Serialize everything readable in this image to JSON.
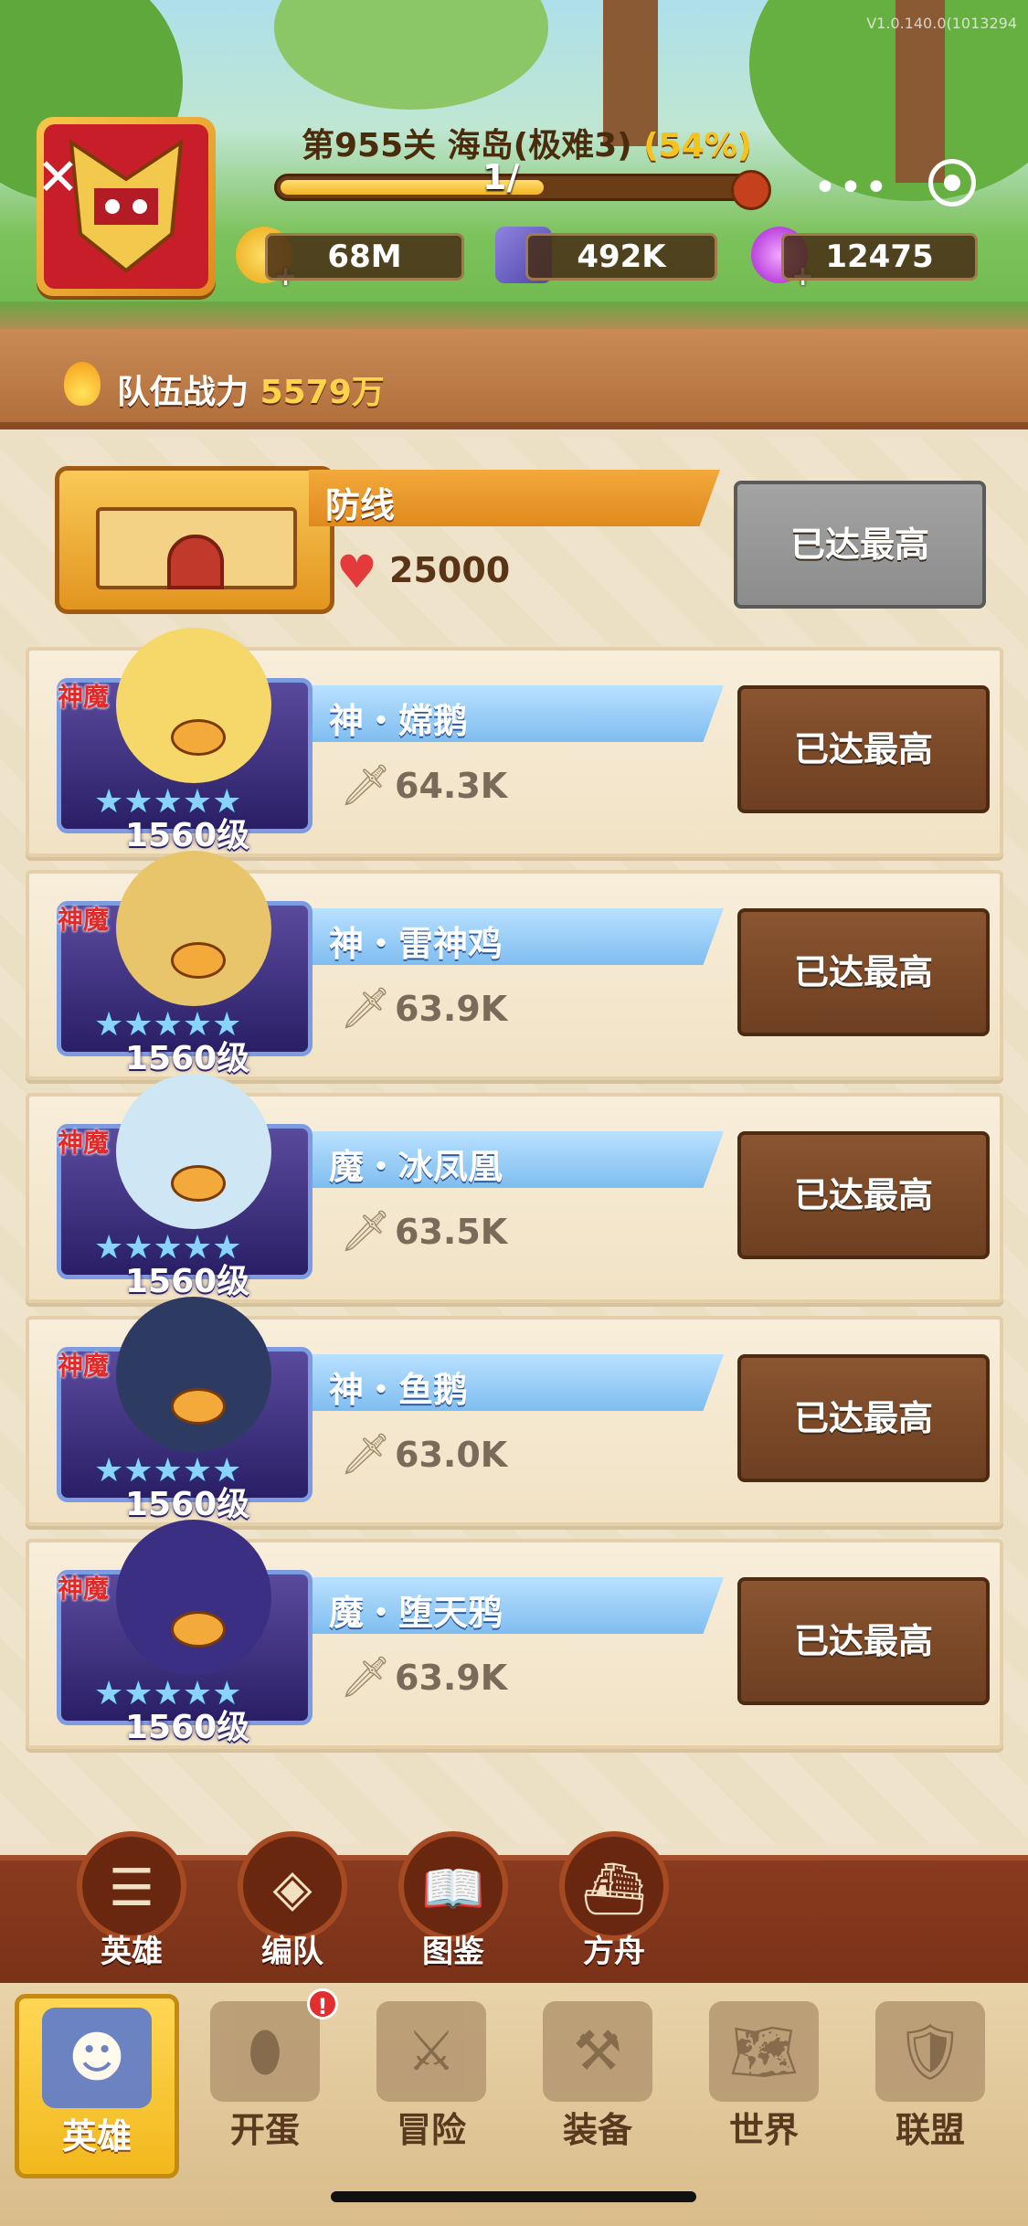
{
  "top": {
    "version": "V1.0.140.0(1013294",
    "stage_title": "第955关 海岛(极难3)",
    "stage_pct": "(54%)",
    "progress_fraction": 0.54,
    "progress_text": "1/",
    "resources": [
      {
        "icon": "gold-coin-icon",
        "value": "68M"
      },
      {
        "icon": "crystal-icon",
        "value": "492K"
      },
      {
        "icon": "gem-icon",
        "value": "12475"
      }
    ]
  },
  "team_power": {
    "label": "队伍战力",
    "value": "5579万"
  },
  "defense": {
    "name": "防线",
    "hp": "25000",
    "button": "已达最高"
  },
  "heroes": [
    {
      "tag": "神魔",
      "name": "神・嫦鹅",
      "power": "64.3K",
      "level": "1560级",
      "stars": "★★★★★",
      "button": "已达最高",
      "face_color": "#f5d76a"
    },
    {
      "tag": "神魔",
      "name": "神・雷神鸡",
      "power": "63.9K",
      "level": "1560级",
      "stars": "★★★★★",
      "button": "已达最高",
      "face_color": "#e8c56b"
    },
    {
      "tag": "神魔",
      "name": "魔・冰凤凰",
      "power": "63.5K",
      "level": "1560级",
      "stars": "★★★★★",
      "button": "已达最高",
      "face_color": "#cfe7f5"
    },
    {
      "tag": "神魔",
      "name": "神・鱼鹅",
      "power": "63.0K",
      "level": "1560级",
      "stars": "★★★★★",
      "button": "已达最高",
      "face_color": "#2d3b63"
    },
    {
      "tag": "神魔",
      "name": "魔・堕天鸦",
      "power": "63.9K",
      "level": "1560级",
      "stars": "★★★★★",
      "button": "已达最高",
      "face_color": "#3b2f84"
    }
  ],
  "sub_nav": [
    {
      "icon": "list-icon",
      "label": "英雄"
    },
    {
      "icon": "formation-icon",
      "label": "编队"
    },
    {
      "icon": "book-icon",
      "label": "图鉴"
    },
    {
      "icon": "ark-icon",
      "label": "方舟"
    }
  ],
  "main_nav": [
    {
      "icon": "hero-icon",
      "label": "英雄",
      "active": true
    },
    {
      "icon": "egg-icon",
      "label": "开蛋",
      "badge": "!"
    },
    {
      "icon": "crossed-swords-icon",
      "label": "冒险"
    },
    {
      "icon": "anvil-icon",
      "label": "装备"
    },
    {
      "icon": "map-icon",
      "label": "世界"
    },
    {
      "icon": "shield-icon",
      "label": "联盟"
    }
  ]
}
